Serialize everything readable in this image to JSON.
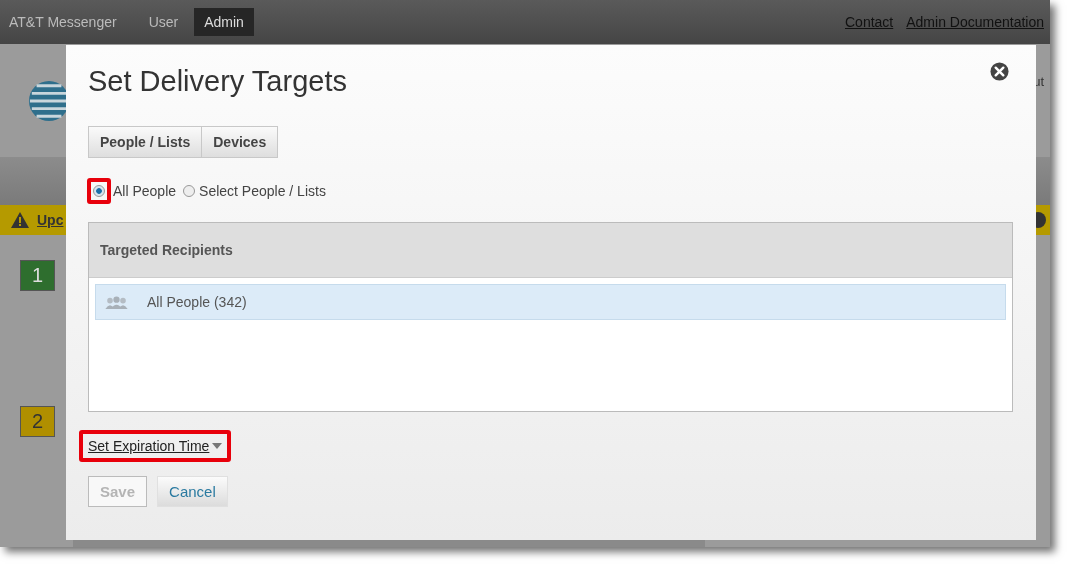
{
  "nav": {
    "app_name": "AT&T Messenger",
    "tabs": [
      {
        "label": "User",
        "selected": false
      },
      {
        "label": "Admin",
        "selected": true
      }
    ],
    "links": [
      "Contact",
      "Admin Documentation"
    ]
  },
  "background": {
    "header_text": "ut",
    "alert_text": "Upc",
    "steps": [
      {
        "number": "1",
        "color": "#2e6e2e"
      },
      {
        "number": "2",
        "color": "#b08f00"
      }
    ]
  },
  "dialog": {
    "title": "Set Delivery Targets",
    "tabs": [
      "People / Lists",
      "Devices"
    ],
    "target_options": [
      {
        "label": "All People",
        "selected": true,
        "highlighted": true
      },
      {
        "label": "Select People / Lists",
        "selected": false,
        "highlighted": false
      }
    ],
    "recipients": {
      "header": "Targeted Recipients",
      "items": [
        {
          "label": "All People (342)",
          "selected": true
        }
      ]
    },
    "expiration_link": {
      "label": "Set Expiration Time",
      "highlighted": true
    },
    "buttons": [
      {
        "label": "Save",
        "disabled": true
      },
      {
        "label": "Cancel",
        "disabled": false
      }
    ]
  }
}
